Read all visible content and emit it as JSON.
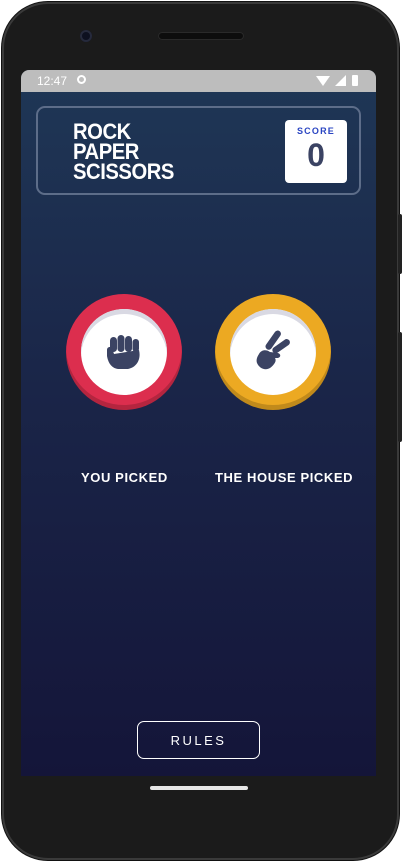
{
  "status_bar": {
    "time": "12:47",
    "icons": [
      "settings-icon",
      "wifi-icon",
      "signal-icon",
      "battery-icon"
    ]
  },
  "header": {
    "title_lines": [
      "ROCK",
      "PAPER",
      "SCISSORS"
    ],
    "score_label": "SCORE",
    "score_value": "0"
  },
  "game": {
    "player_pick": {
      "label": "YOU PICKED",
      "choice_icon": "rock-icon",
      "ring_color": "#dc2e4e"
    },
    "house_pick": {
      "label": "THE HOUSE PICKED",
      "choice_icon": "scissors-icon",
      "ring_color": "#eca922"
    }
  },
  "footer": {
    "rules_label": "RULES"
  },
  "colors": {
    "background_top": "#1f3756",
    "background_bottom": "#141539",
    "header_border": "#5d6d89",
    "score_label": "#2a45c2",
    "dark_text": "#3b4363"
  }
}
